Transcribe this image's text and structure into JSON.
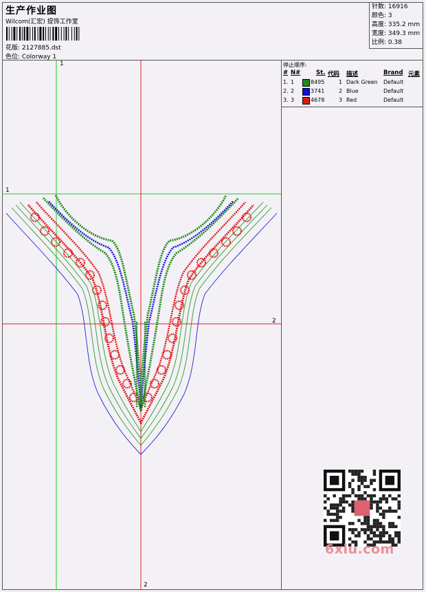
{
  "header": {
    "title": "生产作业图",
    "subtitle": "Wilcom(汇宏) 提饰工作室",
    "file_label": "花版: 2127885.dst",
    "colorway_label": "色位: Colorway 1"
  },
  "stats": [
    {
      "label": "针数:",
      "value": "16916"
    },
    {
      "label": "颜色:",
      "value": "3"
    },
    {
      "label": "高度:",
      "value": "335.2 mm"
    },
    {
      "label": "宽度:",
      "value": "349.3 mm"
    },
    {
      "label": "比例:",
      "value": "0.38"
    }
  ],
  "stop_sequence": {
    "title": "停止顺序:",
    "headers": {
      "num": "#",
      "n": "N#",
      "st": "St.",
      "code": "代码",
      "desc": "描述",
      "brand": "Brand",
      "elem": "元素"
    },
    "rows": [
      {
        "num": "1.",
        "n": "1",
        "color": "#1e8a1e",
        "st": "8495",
        "code": "1",
        "desc": "Dark Green",
        "brand": "Default"
      },
      {
        "num": "2.",
        "n": "2",
        "color": "#1010d8",
        "st": "3741",
        "code": "2",
        "desc": "Blue",
        "brand": "Default"
      },
      {
        "num": "3.",
        "n": "3",
        "color": "#e01818",
        "st": "4678",
        "code": "3",
        "desc": "Red",
        "brand": "Default"
      }
    ]
  },
  "guides": {
    "green_label": "1",
    "red_label": "2"
  },
  "watermark": "6xiu.com",
  "colors": {
    "green_guide": "#22cc22",
    "red_guide": "#dd2020",
    "outline_green": "#2a9a2a",
    "outline_blue": "#2020d0"
  }
}
